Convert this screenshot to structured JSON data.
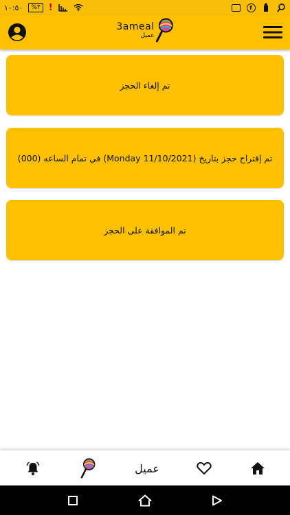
{
  "status_bar": {
    "time": "١٠:٥٠",
    "battery": "%٣"
  },
  "header": {
    "brand_name": "3ameal",
    "brand_sub": "عميل"
  },
  "messages": [
    {
      "text": "تم إلغاء الحجز"
    },
    {
      "text": "تم إقتراح حجز بتاريخ (Monday 11/10/2021) في تمام الساعه (000)"
    },
    {
      "text": "تم الموافقة على الحجز"
    }
  ],
  "bottom_nav": {
    "center_label": "عميل"
  },
  "icons": {
    "profile": "account-circle-icon",
    "menu": "hamburger-menu-icon",
    "bell": "bell-icon",
    "logo": "lollipop-logo-icon",
    "heart": "heart-icon",
    "home": "home-icon"
  },
  "colors": {
    "accent": "#ffc000",
    "status_bar": "#f7be0a"
  }
}
